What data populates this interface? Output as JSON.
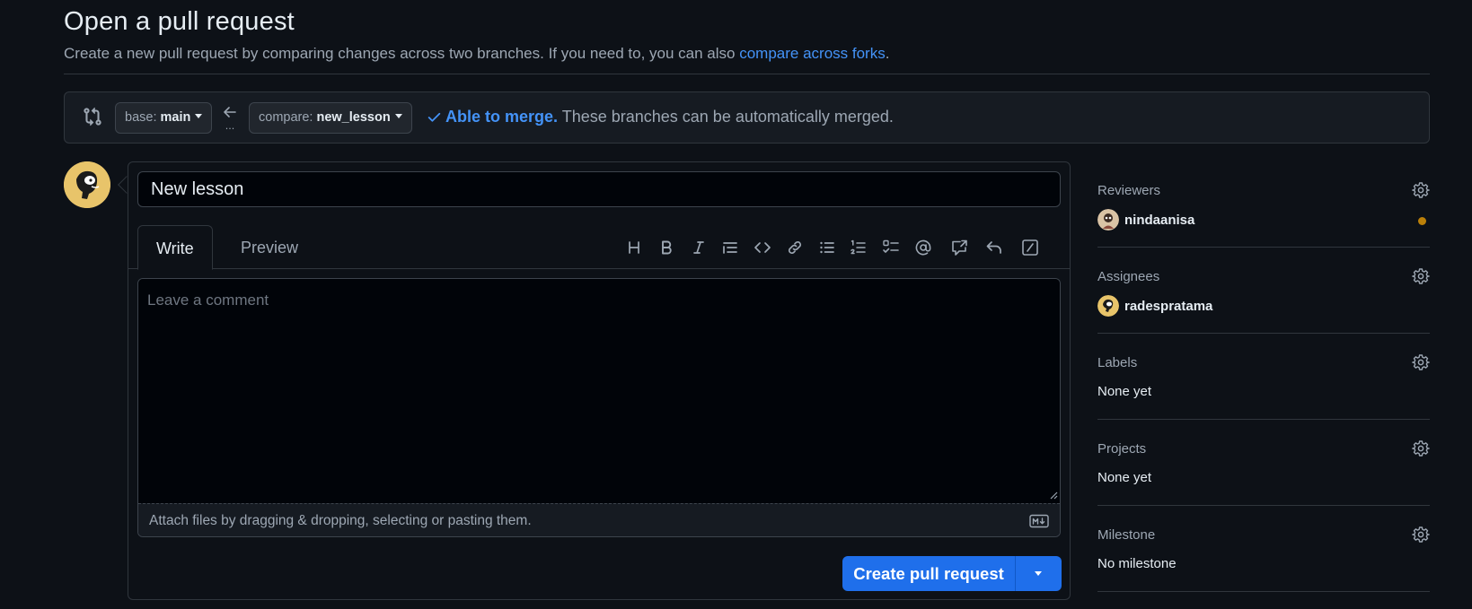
{
  "header": {
    "title": "Open a pull request",
    "subtitle": "Create a new pull request by comparing changes across two branches. If you need to, you can also ",
    "subtitle_link": "compare across forks",
    "subtitle_end": "."
  },
  "range": {
    "base_label": "base:",
    "base_value": "main",
    "compare_label": "compare:",
    "compare_value": "new_lesson",
    "arrow_dots": "...",
    "merge_ok": "Able to merge.",
    "merge_text": " These branches can be automatically merged."
  },
  "composer": {
    "title_value": "New lesson",
    "tabs": [
      {
        "label": "Write",
        "active": true
      },
      {
        "label": "Preview",
        "active": false
      }
    ],
    "comment_placeholder": "Leave a comment",
    "attach_text": "Attach files by dragging & dropping, selecting or pasting them.",
    "submit_label": "Create pull request",
    "toolbar_icons": [
      "heading-icon",
      "bold-icon",
      "italic-icon",
      "quote-icon",
      "code-icon",
      "link-icon",
      "unordered-list-icon",
      "ordered-list-icon",
      "task-list-icon",
      "mention-icon",
      "cross-reference-icon",
      "reply-icon",
      "slash-commands-icon"
    ]
  },
  "sidebar": {
    "reviewers": {
      "heading": "Reviewers",
      "user": "nindaanisa"
    },
    "assignees": {
      "heading": "Assignees",
      "user": "radespratama"
    },
    "labels": {
      "heading": "Labels",
      "value": "None yet"
    },
    "projects": {
      "heading": "Projects",
      "value": "None yet"
    },
    "milestone": {
      "heading": "Milestone",
      "value": "No milestone"
    }
  },
  "colors": {
    "background": "#0d1117",
    "accent_blue": "#4493f8",
    "submit_blue": "#1f6feb",
    "pending_dot": "#bb8009",
    "avatar_yellow": "#e8c46a"
  }
}
